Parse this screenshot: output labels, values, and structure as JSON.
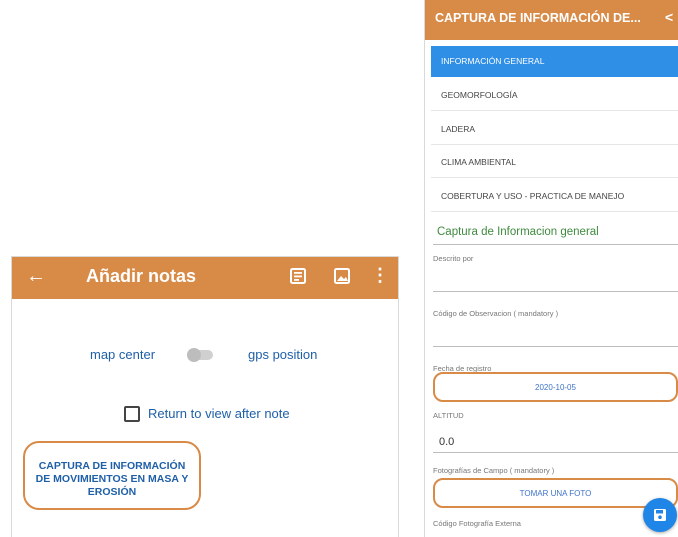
{
  "left_screen": {
    "appbar": {
      "back_icon": "arrow-left-icon",
      "title": "Añadir notas",
      "icons": [
        "notes-list-icon",
        "image-icon",
        "more-vert-icon"
      ],
      "background_color": "#d88a47"
    },
    "map_center_label": "map center",
    "gps_position_label": "gps position",
    "toggle_on": false,
    "return_to_view_label": "Return to view after note",
    "return_to_view_checked": false,
    "capture_button_label": "CAPTURA DE INFORMACIÓN DE MOVIMIENTOS EN MASA Y EROSIÓN"
  },
  "right_screen": {
    "appbar": {
      "title": "CAPTURA DE INFORMACIÓN DE...",
      "share_icon": "share-icon",
      "background_color": "#d88a47"
    },
    "tabs": [
      {
        "label": "INFORMACIÓN GENERAL",
        "selected": true
      },
      {
        "label": "GEOMORFOLOGÍA",
        "selected": false
      },
      {
        "label": "LADERA",
        "selected": false
      },
      {
        "label": "CLIMA AMBIENTAL",
        "selected": false
      },
      {
        "label": "COBERTURA Y USO - PRACTICA DE MANEJO",
        "selected": false
      }
    ],
    "section_title": "Captura de Informacion general",
    "fields": {
      "descrito_por_label": "Descrito por",
      "codigo_observacion_label": "Código de Observacion ( mandatory )",
      "fecha_registro_label": "Fecha de registro",
      "fecha_registro_value": "2020-10-05",
      "altitud_label": "ALTITUD",
      "altitud_value": "0.0",
      "fotografias_label": "Fotografías de Campo ( mandatory )",
      "tomar_foto_label": "TOMAR UNA FOTO",
      "codigo_fotografia_label": "Código Fotografía Externa"
    },
    "fab_icon": "save-icon",
    "accent_color": "#2f8ee6"
  }
}
